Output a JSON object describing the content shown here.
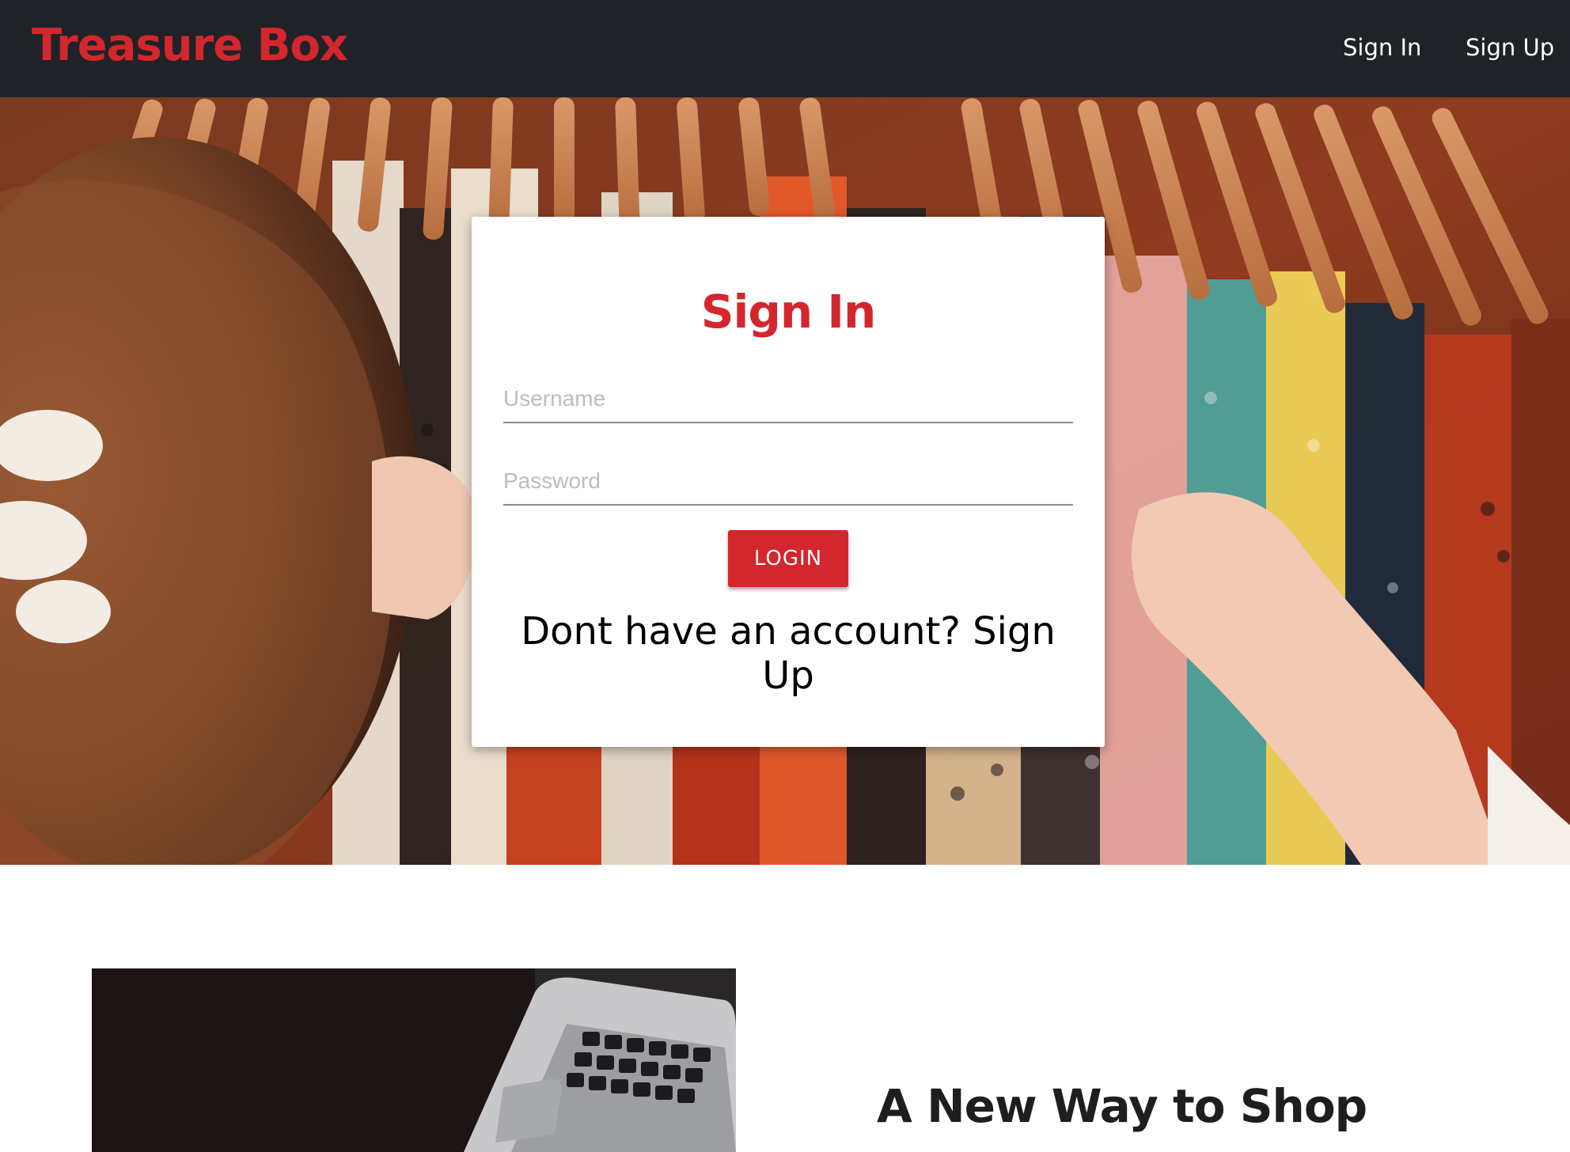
{
  "navbar": {
    "brand": "Treasure Box",
    "links": [
      "Sign In",
      "Sign Up"
    ]
  },
  "hero": {
    "image": "clothing-rack-photo"
  },
  "login_card": {
    "title": "Sign In",
    "username_placeholder": "Username",
    "password_placeholder": "Password",
    "login_button": "LOGIN",
    "signup_prompt": "Dont have an account? Sign Up"
  },
  "feature": {
    "image": "laptop-photo",
    "heading": "A New Way to Shop"
  },
  "colors": {
    "brand_red": "#d4262d",
    "navbar_bg": "#1f2327",
    "text_dark": "#1e1e1e"
  }
}
